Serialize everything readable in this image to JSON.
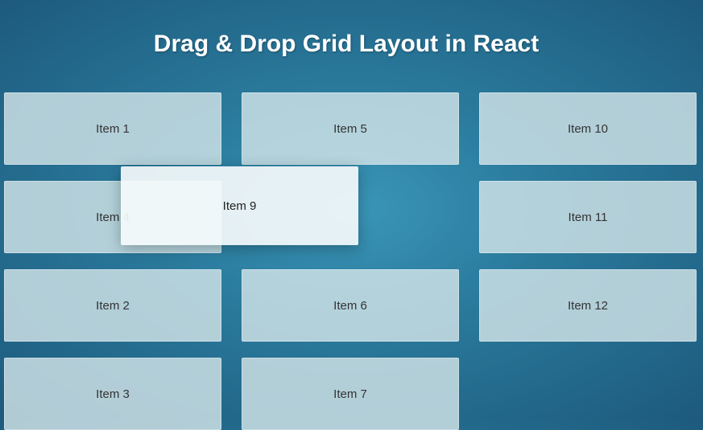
{
  "title": "Drag & Drop Grid Layout in React",
  "grid": {
    "r1c1": "Item 1",
    "r1c2": "Item 5",
    "r1c3": "Item 10",
    "r2c1": "Item 4",
    "r2c3": "Item 11",
    "r3c1": "Item 2",
    "r3c2": "Item 6",
    "r3c3": "Item 12",
    "r4c1": "Item 3",
    "r4c2": "Item 7"
  },
  "dragging": {
    "label": "Item 9"
  }
}
